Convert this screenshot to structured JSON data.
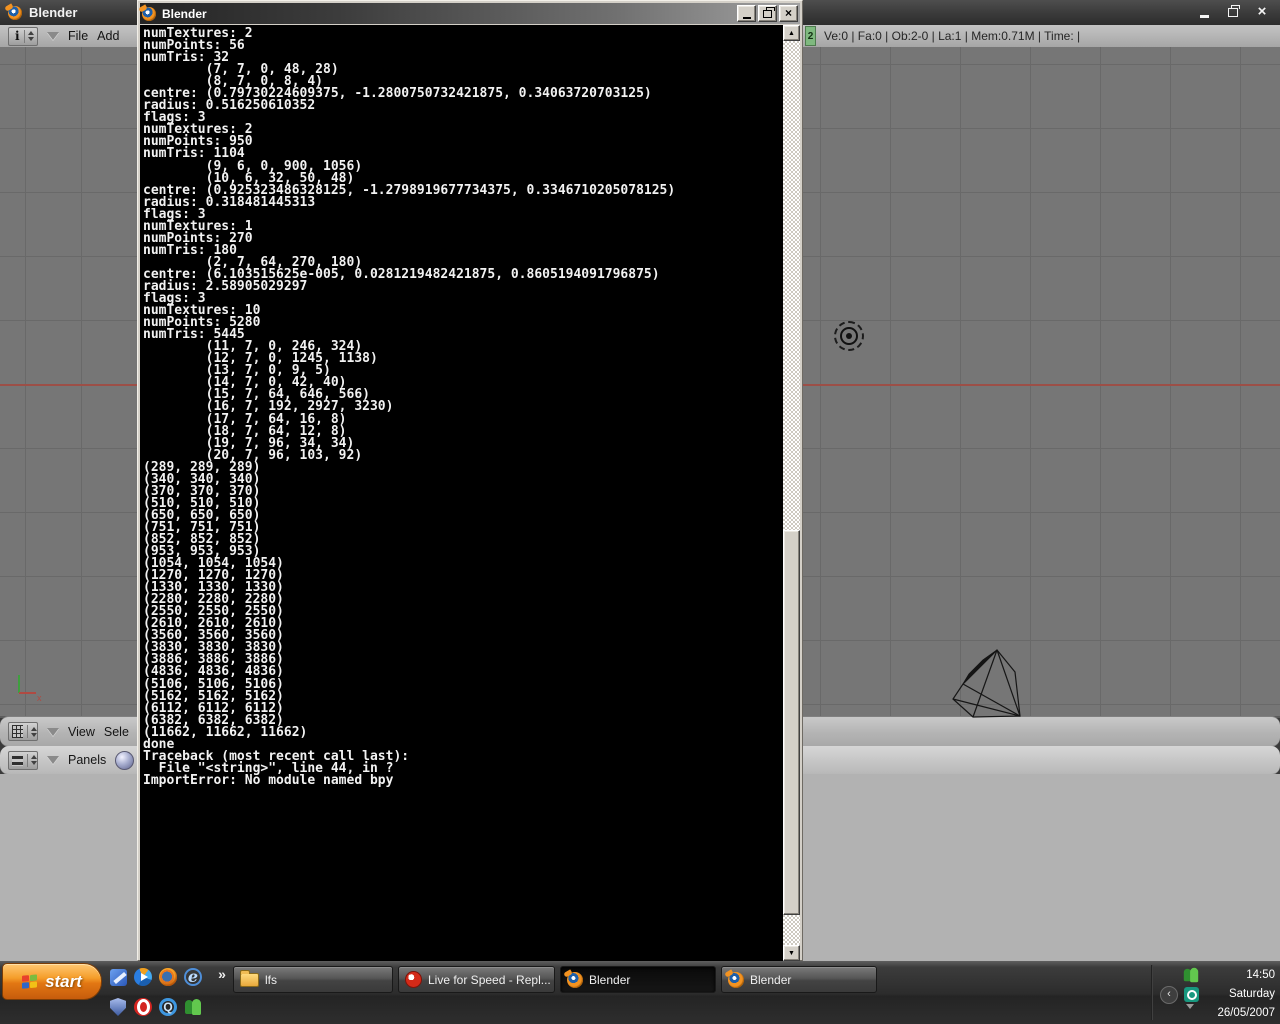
{
  "main_window": {
    "title": "Blender",
    "menubar": {
      "file": "File",
      "add": "Add"
    },
    "stats_badge": "2",
    "stats_text": "Ve:0 | Fa:0 | Ob:2-0 | La:1  | Mem:0.71M  | Time: |",
    "viewport_menu": {
      "view": "View",
      "select": "Sele"
    },
    "panels_label": "Panels"
  },
  "console_window": {
    "title": "Blender",
    "text": "numTextures: 2\nnumPoints: 56\nnumTris: 32\n        (7, 7, 0, 48, 28)\n        (8, 7, 0, 8, 4)\ncentre: (0.79730224609375, -1.2800750732421875, 0.34063720703125)\nradius: 0.516250610352\nflags: 3\nnumTextures: 2\nnumPoints: 950\nnumTris: 1104\n        (9, 6, 0, 900, 1056)\n        (10, 6, 32, 50, 48)\ncentre: (0.925323486328125, -1.2798919677734375, 0.3346710205078125)\nradius: 0.318481445313\nflags: 3\nnumTextures: 1\nnumPoints: 270\nnumTris: 180\n        (2, 7, 64, 270, 180)\ncentre: (6.103515625e-005, 0.0281219482421875, 0.8605194091796875)\nradius: 2.58905029297\nflags: 3\nnumTextures: 10\nnumPoints: 5280\nnumTris: 5445\n        (11, 7, 0, 246, 324)\n        (12, 7, 0, 1245, 1138)\n        (13, 7, 0, 9, 5)\n        (14, 7, 0, 42, 40)\n        (15, 7, 64, 646, 566)\n        (16, 7, 192, 2927, 3230)\n        (17, 7, 64, 16, 8)\n        (18, 7, 64, 12, 8)\n        (19, 7, 96, 34, 34)\n        (20, 7, 96, 103, 92)\n(289, 289, 289)\n(340, 340, 340)\n(370, 370, 370)\n(510, 510, 510)\n(650, 650, 650)\n(751, 751, 751)\n(852, 852, 852)\n(953, 953, 953)\n(1054, 1054, 1054)\n(1270, 1270, 1270)\n(1330, 1330, 1330)\n(2280, 2280, 2280)\n(2550, 2550, 2550)\n(2610, 2610, 2610)\n(3560, 3560, 3560)\n(3830, 3830, 3830)\n(3886, 3886, 3886)\n(4836, 4836, 4836)\n(5106, 5106, 5106)\n(5162, 5162, 5162)\n(6112, 6112, 6112)\n(6382, 6382, 6382)\n(11662, 11662, 11662)\ndone\nTraceback (most recent call last):\n  File \"<string>\", line 44, in ?\nImportError: No module named bpy"
  },
  "taskbar": {
    "start_label": "start",
    "quick_launch_row1": [
      "movie-maker",
      "media-player",
      "firefox",
      "internet-explorer"
    ],
    "quick_launch_row2": [
      "shield",
      "opera",
      "quicktime",
      "messenger"
    ],
    "buttons": [
      {
        "label": "lfs",
        "icon": "folder"
      },
      {
        "label": "Live for Speed - Repl...",
        "icon": "lfs"
      },
      {
        "label": "Blender",
        "icon": "blender",
        "state": "active"
      },
      {
        "label": "Blender",
        "icon": "blender",
        "state": "normal"
      }
    ],
    "tray": {
      "time": "14:50",
      "day": "Saturday",
      "date": "26/05/2007"
    }
  },
  "icons": {
    "scroll_up": "▲",
    "scroll_down": "▼",
    "chevron_more": "»",
    "tray_collapse": "‹",
    "close": "×",
    "ie_letter": "e",
    "quicktime_letter": "Q"
  },
  "colors": {
    "accent_orange": "#f39321",
    "start_orange": "#f1920f",
    "badge_green": "#7fb97f",
    "console_bg": "#000000",
    "console_text": "#f2f2f2",
    "viewport_bg": "#767676",
    "axis_red": "#9c4f47",
    "taskbar_bg": "#2e2e2e"
  }
}
